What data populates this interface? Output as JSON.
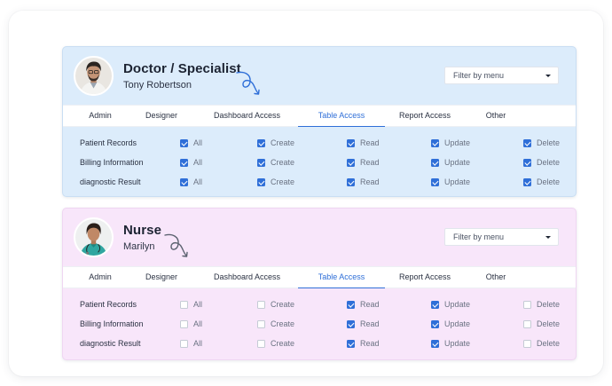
{
  "tabs": [
    "Admin",
    "Designer",
    "Dashboard Access",
    "Table Access",
    "Report Access",
    "Other"
  ],
  "active_tab": "Table Access",
  "filter_placeholder": "Filter by menu",
  "permissions": [
    "All",
    "Create",
    "Read",
    "Update",
    "Delete"
  ],
  "rows": [
    "Patient Records",
    "Billing Information",
    "diagnostic Result"
  ],
  "colors": {
    "accent": "#2f6fd8",
    "doctor_card_bg": "#dcecfb",
    "nurse_card_bg": "#f8e6fa",
    "checkbox_border": "#c5cbd5"
  },
  "cards": [
    {
      "id": "doctor",
      "role": "Doctor / Specialist",
      "name": "Tony Robertson",
      "squiggle_color": "#2f6fd8",
      "checked": [
        [
          true,
          true,
          true,
          true,
          true
        ],
        [
          true,
          true,
          true,
          true,
          true
        ],
        [
          true,
          true,
          true,
          true,
          true
        ]
      ]
    },
    {
      "id": "nurse",
      "role": "Nurse",
      "name": "Marilyn",
      "squiggle_color": "#5c6270",
      "checked": [
        [
          false,
          false,
          true,
          true,
          false
        ],
        [
          false,
          false,
          true,
          true,
          false
        ],
        [
          false,
          false,
          true,
          true,
          false
        ]
      ]
    }
  ]
}
